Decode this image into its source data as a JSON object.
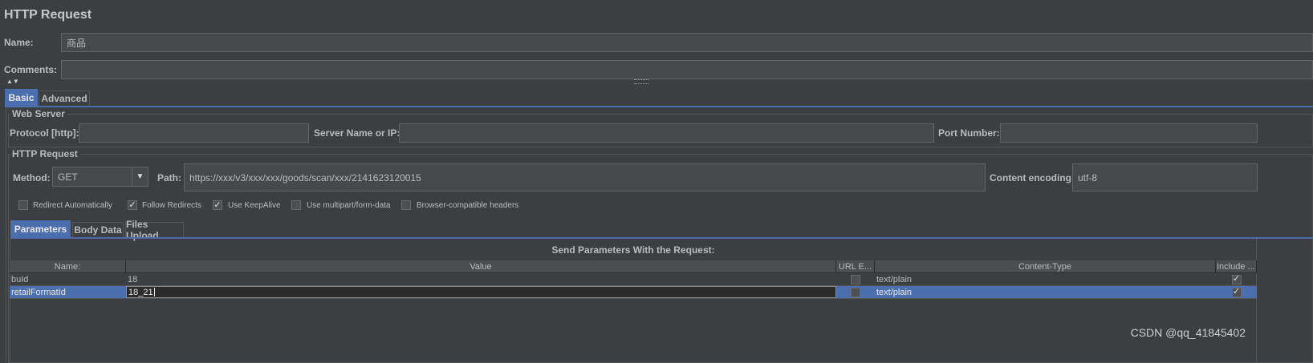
{
  "window": {
    "title": "HTTP Request"
  },
  "name_field": {
    "label": "Name:",
    "value": "商品"
  },
  "comments_field": {
    "label": "Comments:",
    "value": ""
  },
  "main_tabs": [
    {
      "label": "Basic",
      "active": true
    },
    {
      "label": "Advanced",
      "active": false
    }
  ],
  "web_server": {
    "group_title": "Web Server",
    "protocol_label": "Protocol [http]:",
    "protocol_value": "",
    "server_label": "Server Name or IP:",
    "server_value": "",
    "port_label": "Port Number:",
    "port_value": ""
  },
  "http_request": {
    "group_title": "HTTP Request",
    "method_label": "Method:",
    "method_value": "GET",
    "path_label": "Path:",
    "path_value": "https://xxx/v3/xxx/xxx/goods/scan/xxx/2141623120015",
    "encoding_label": "Content encoding:",
    "encoding_value": "utf-8"
  },
  "options": [
    {
      "label": "Redirect Automatically",
      "checked": false
    },
    {
      "label": "Follow Redirects",
      "checked": true
    },
    {
      "label": "Use KeepAlive",
      "checked": true
    },
    {
      "label": "Use multipart/form-data",
      "checked": false
    },
    {
      "label": "Browser-compatible headers",
      "checked": false
    }
  ],
  "param_tabs": [
    {
      "label": "Parameters",
      "active": true
    },
    {
      "label": "Body Data",
      "active": false
    },
    {
      "label": "Files Upload",
      "active": false
    }
  ],
  "params_table": {
    "caption": "Send Parameters With the Request:",
    "columns": [
      "Name:",
      "Value",
      "URL E...",
      "Content-Type",
      "Include ..."
    ],
    "rows": [
      {
        "name": "buId",
        "value": "18",
        "url_encode": false,
        "content_type": "text/plain",
        "include": true,
        "selected": false
      },
      {
        "name": "retailFormatId",
        "value": "18_21",
        "url_encode": false,
        "content_type": "text/plain",
        "include": true,
        "selected": true
      }
    ]
  },
  "watermark": "CSDN @qq_41845402"
}
